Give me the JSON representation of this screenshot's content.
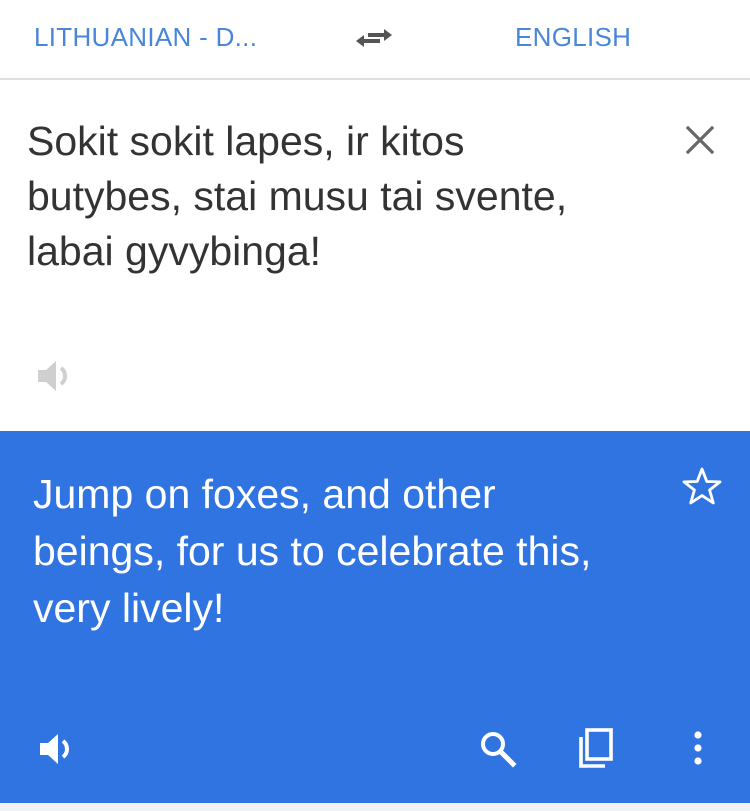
{
  "language_bar": {
    "source_language": "LITHUANIAN - D...",
    "target_language": "ENGLISH",
    "swap_icon": "swap-horiz-icon"
  },
  "source": {
    "text": "Sokit sokit lapes, ir kitos butybes, stai musu tai svente, labai gyvybinga!",
    "clear_icon": "close-icon",
    "speaker_icon": "volume-icon"
  },
  "result": {
    "text": "Jump on foxes, and other beings, for us to celebrate this, very lively!",
    "star_icon": "star-outline-icon",
    "speaker_icon": "volume-icon",
    "search_icon": "search-icon",
    "copy_icon": "copy-icon",
    "more_icon": "more-vert-icon"
  },
  "colors": {
    "accent": "#4a86d8",
    "result_background": "#3074e2",
    "source_text": "#333333",
    "muted_icon": "#cfcfcf"
  }
}
